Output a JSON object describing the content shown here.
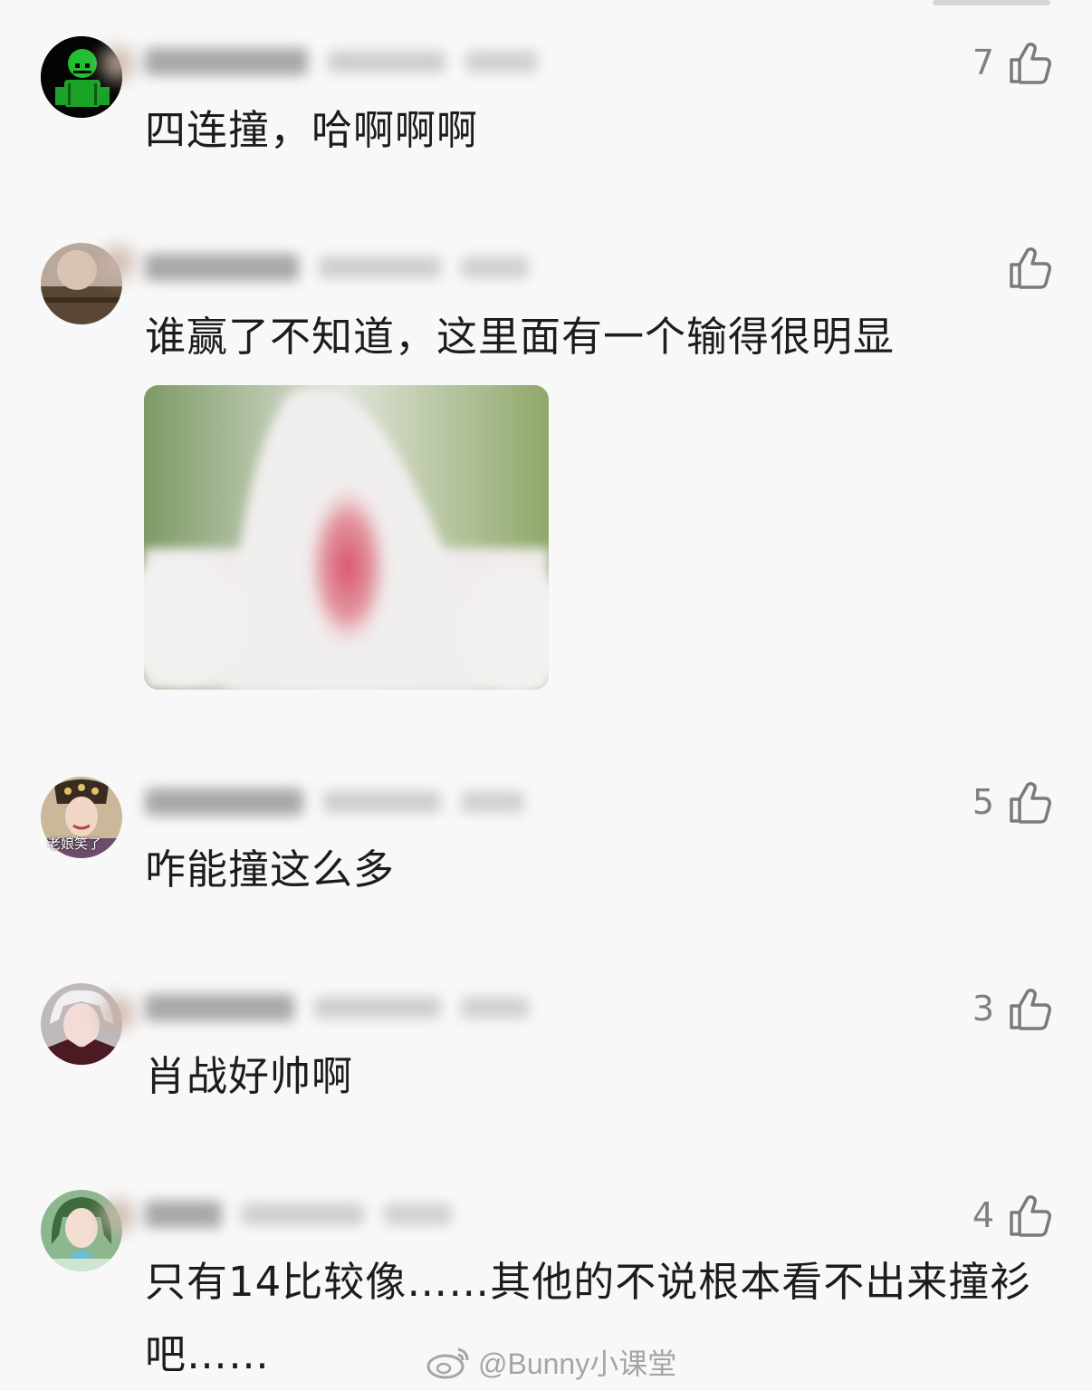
{
  "comments": [
    {
      "id": "c1",
      "avatar": "green-skeleton-avatar",
      "likes": "7",
      "text": "四连撞，哈啊啊啊"
    },
    {
      "id": "c2",
      "avatar": "brown-blurred-avatar",
      "likes": "",
      "text": "谁赢了不知道，这里面有一个输得很明显",
      "image": "white-fluffy-cat-ear-photo"
    },
    {
      "id": "c3",
      "avatar": "costume-drama-woman-avatar",
      "avatar_caption": "老娘笑了",
      "likes": "5",
      "text": "咋能撞这么多"
    },
    {
      "id": "c4",
      "avatar": "anime-white-hair-avatar",
      "likes": "3",
      "text": "肖战好帅啊"
    },
    {
      "id": "c5",
      "avatar": "green-hair-girl-avatar",
      "likes": "4",
      "text": "只有14比较像……其他的不说根本看不出来撞衫吧……"
    }
  ],
  "icons": {
    "like": "thumbs-up-icon",
    "weibo": "weibo-logo-icon"
  },
  "watermark": "@Bunny小课堂",
  "colors": {
    "background": "#f8f8f8",
    "text": "#1c1c1c",
    "like": "#808080"
  }
}
